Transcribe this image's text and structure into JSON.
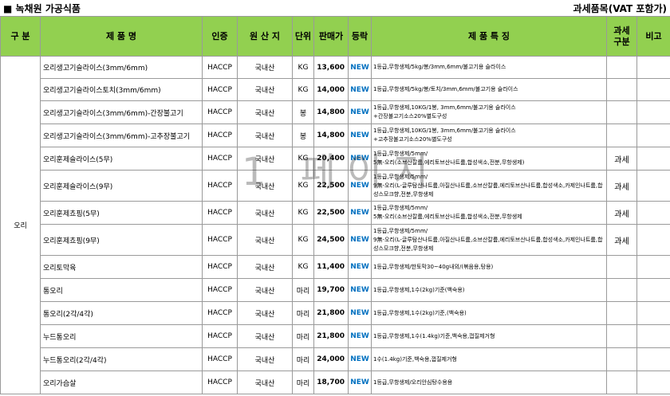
{
  "header": {
    "title": "■ 녹채원 가공식품",
    "tax_note": "과세품목(VAT 포함가)"
  },
  "columns": {
    "category": "구 분",
    "product": "제 품 명",
    "cert": "인증",
    "origin": "원 산 지",
    "unit": "단위",
    "price": "판매가",
    "reg": "등락",
    "features": "제 품 특 징",
    "tax": "과세\n구분",
    "note": "비고"
  },
  "category_label": "오리",
  "watermark": "1 페이지",
  "rows": [
    {
      "name": "오리생고기슬라이스(3mm/6mm)",
      "cert": "HACCP",
      "origin": "국내산",
      "unit": "KG",
      "price": "13,600",
      "badge": "NEW",
      "features": "1등급,무항생제/5kg/봉/3mm,6mm/불고기용 슬라이스",
      "tax": ""
    },
    {
      "name": "오리생고기슬라이스토치(3mm/6mm)",
      "cert": "HACCP",
      "origin": "국내산",
      "unit": "KG",
      "price": "14,000",
      "badge": "NEW",
      "features": "1등급,무항생제/5kg/봉/토치/3mm,6mm/불고기용 슬라이스",
      "tax": ""
    },
    {
      "name": "오리생고기슬라이스(3mm/6mm)-간장불고기",
      "cert": "HACCP",
      "origin": "국내산",
      "unit": "봉",
      "price": "14,800",
      "badge": "NEW",
      "features": "1등급,무항생제,10KG/1봉, 3mm,6mm/불고기용 슬라이스\n+간장불고기소스20%별도구성",
      "tax": ""
    },
    {
      "name": "오리생고기슬라이스(3mm/6mm)-고추장불고기",
      "cert": "HACCP",
      "origin": "국내산",
      "unit": "봉",
      "price": "14,800",
      "badge": "NEW",
      "features": "1등급,무항생제,10KG/1봉, 3mm,6mm/불고기용 슬라이스\n+고추장불고기소스20%별도구성",
      "tax": ""
    },
    {
      "name": "오리훈제슬라이스(5무)",
      "cert": "HACCP",
      "origin": "국내산",
      "unit": "KG",
      "price": "20,400",
      "badge": "NEW",
      "features": "1등급,무항생제/5mm/\n5無-오리(소브산칼륨,에리토브산나트륨,합성색소,전분,무항생제)",
      "tax": "과세"
    },
    {
      "name": "오리훈제슬라이스(9무)",
      "cert": "HACCP",
      "origin": "국내산",
      "unit": "KG",
      "price": "22,500",
      "badge": "NEW",
      "features": "1등급,무항생제/5mm/\n9無-오리(L-글루탐산나트륨,아질산나트륨,소브산칼륨,에리토브산나트륨,합성색소,카제인나트륨,합성스모크향,전분,무항생제",
      "tax": "과세"
    },
    {
      "name": "오리훈제쵸핑(5무)",
      "cert": "HACCP",
      "origin": "국내산",
      "unit": "KG",
      "price": "22,500",
      "badge": "NEW",
      "features": "1등급,무항생제/5mm/\n5無-오리(소브산칼륨,에리토브산나트륨,합성색소,전분,무항생제",
      "tax": "과세"
    },
    {
      "name": "오리훈제쵸핑(9무)",
      "cert": "HACCP",
      "origin": "국내산",
      "unit": "KG",
      "price": "24,500",
      "badge": "NEW",
      "features": "1등급,무항생제/5mm/\n9無-오리(L-글루탐산나트륨,아질산나트륨,소브산칼륨,에리토브산나트륨,합성색소,카제인나트륨,합성스모크향,전분,무항생제",
      "tax": "과세"
    },
    {
      "name": "오리토막육",
      "cert": "HACCP",
      "origin": "국내산",
      "unit": "KG",
      "price": "11,400",
      "badge": "NEW",
      "features": "1등급,무항생제/한토막30~40g내외/(볶음용,탕용)",
      "tax": ""
    },
    {
      "name": "통오리",
      "cert": "HACCP",
      "origin": "국내산",
      "unit": "마리",
      "price": "19,700",
      "badge": "NEW",
      "features": "1등급,무항생제,1수(2kg)기준(백숙용)",
      "tax": ""
    },
    {
      "name": "통오리(2각/4각)",
      "cert": "HACCP",
      "origin": "국내산",
      "unit": "마리",
      "price": "21,800",
      "badge": "NEW",
      "features": "1등급,무항생제,1수(2kg)기준,(백숙용)",
      "tax": ""
    },
    {
      "name": "누드통오리",
      "cert": "HACCP",
      "origin": "국내산",
      "unit": "마리",
      "price": "21,800",
      "badge": "NEW",
      "features": "1등급,무항생제,1수(1.4kg)기준,백숙용,껍질제거형",
      "tax": ""
    },
    {
      "name": "누드통오리(2각/4각)",
      "cert": "HACCP",
      "origin": "국내산",
      "unit": "마리",
      "price": "24,000",
      "badge": "NEW",
      "features": "1수(1.4kg)기준,백숙용,껍질제거형",
      "tax": ""
    },
    {
      "name": "오리가슴살",
      "cert": "HACCP",
      "origin": "국내산",
      "unit": "마리",
      "price": "18,700",
      "badge": "NEW",
      "features": "1등급,무항생제/오리안심탕수용용",
      "tax": ""
    }
  ]
}
